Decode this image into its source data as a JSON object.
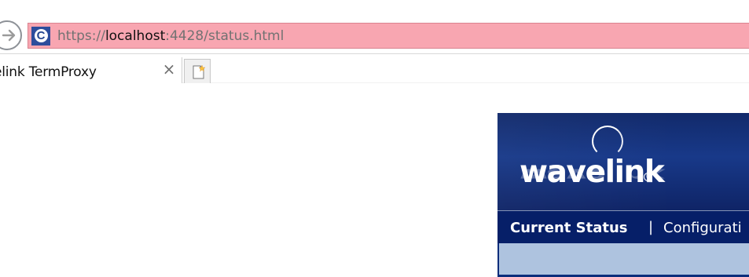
{
  "browser": {
    "address_bar": {
      "protocol": "https://",
      "host": "localhost",
      "path": ":4428/status.html",
      "site_icon": "C-shield-icon"
    },
    "tab": {
      "title": "elink TermProxy",
      "close_symbol": "×"
    },
    "new_tab_icon": "new-tab-icon"
  },
  "page": {
    "logo": {
      "text": "wavelink",
      "registered_mark": "®"
    },
    "nav": {
      "current": "Current Status",
      "separator": "|",
      "config": "Configurati"
    }
  },
  "colors": {
    "address_background": "#f8a6b1",
    "banner": "#183989",
    "nav": "#061f68",
    "strip": "#aec3df"
  }
}
